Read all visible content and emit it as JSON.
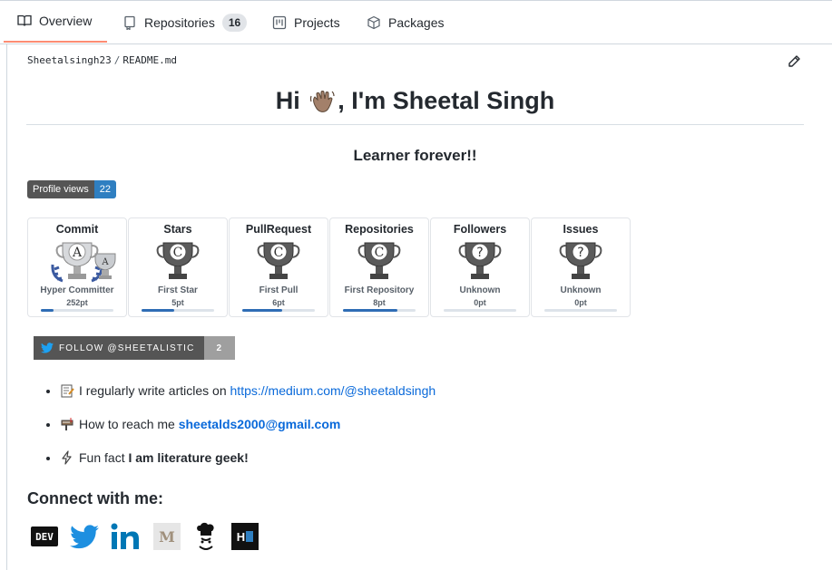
{
  "tabs": [
    {
      "label": "Overview",
      "icon": "book-icon",
      "active": true
    },
    {
      "label": "Repositories",
      "icon": "repo-icon",
      "count": "16"
    },
    {
      "label": "Projects",
      "icon": "project-icon"
    },
    {
      "label": "Packages",
      "icon": "package-icon"
    }
  ],
  "readme": {
    "owner": "Sheetalsingh23",
    "separator": "/",
    "file": "README.md",
    "heading_pre": "Hi",
    "heading_post": ", I'm Sheetal Singh",
    "subheading": "Learner forever!!",
    "profile_views_label": "Profile views",
    "profile_views_count": "22"
  },
  "trophies": [
    {
      "title": "Commit",
      "rank_letter": "A",
      "rank": "Hyper Committer",
      "points": "252pt",
      "progress": 0.18
    },
    {
      "title": "Stars",
      "rank_letter": "C",
      "rank": "First Star",
      "points": "5pt",
      "progress": 0.45
    },
    {
      "title": "PullRequest",
      "rank_letter": "C",
      "rank": "First Pull",
      "points": "6pt",
      "progress": 0.55
    },
    {
      "title": "Repositories",
      "rank_letter": "C",
      "rank": "First Repository",
      "points": "8pt",
      "progress": 0.75
    },
    {
      "title": "Followers",
      "rank_letter": "?",
      "rank": "Unknown",
      "points": "0pt",
      "progress": 0
    },
    {
      "title": "Issues",
      "rank_letter": "?",
      "rank": "Unknown",
      "points": "0pt",
      "progress": 0
    }
  ],
  "twitter": {
    "label": "FOLLOW @SHEETALISTIC",
    "count": "2"
  },
  "bullets": [
    {
      "text": "I regularly write articles on ",
      "link": "https://medium.com/@sheetaldsingh",
      "icon": "memo-icon"
    },
    {
      "text": "How to reach me ",
      "link": "sheetalds2000@gmail.com",
      "icon": "mailbox-icon"
    },
    {
      "text": "Fun fact ",
      "bold": "I am literature geek!",
      "icon": "zap-icon"
    }
  ],
  "connect": {
    "heading": "Connect with me:",
    "dev_label": "DEV",
    "medium_label": "M",
    "hashnode_label": "H",
    "icons": [
      "dev-icon",
      "twitter-icon",
      "linkedin-icon",
      "medium-icon",
      "codechef-icon",
      "hashnode-icon"
    ]
  },
  "colors": {
    "tab_active": "#fd8c73",
    "link": "#0969da",
    "views_badge": "#2f7fc1",
    "twitter_blue": "#1da1f2",
    "linkedin_blue": "#0077b5"
  }
}
